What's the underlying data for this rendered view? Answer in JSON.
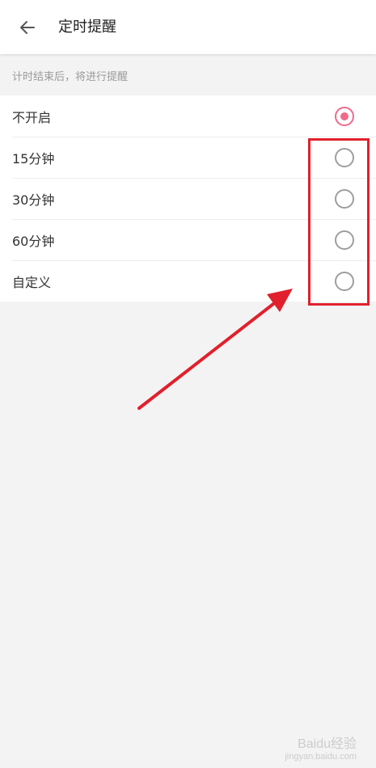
{
  "header": {
    "title": "定时提醒",
    "back_icon": "arrow-left-icon"
  },
  "hint": "计时结束后，将进行提醒",
  "options": [
    {
      "label": "不开启",
      "selected": true
    },
    {
      "label": "15分钟",
      "selected": false
    },
    {
      "label": "30分钟",
      "selected": false
    },
    {
      "label": "60分钟",
      "selected": false
    },
    {
      "label": "自定义",
      "selected": false
    }
  ],
  "colors": {
    "accent": "#f06a8a",
    "annotation": "#e0202c",
    "background": "#f3f3f3"
  },
  "watermark": {
    "logo_text": "Baidu经验",
    "sub_text": "jingyan.baidu.com"
  }
}
